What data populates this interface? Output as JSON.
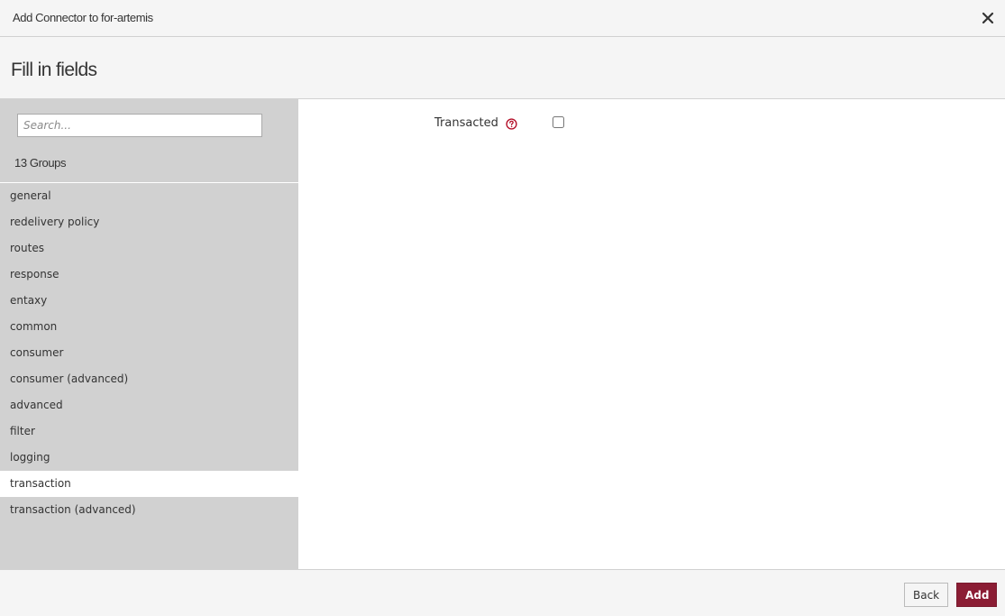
{
  "dialog": {
    "title": "Add Connector to for-artemis",
    "heading": "Fill in fields"
  },
  "icons": {
    "close": "close-icon",
    "help": "help-icon"
  },
  "colors": {
    "accent": "#8b1d34",
    "help_icon": "#b5122b",
    "sidebar_bg": "#d1d1d1",
    "selected_bg": "#ffffff"
  },
  "sidebar": {
    "search_placeholder": "Search...",
    "group_count": "13 Groups",
    "groups": [
      {
        "label": "general"
      },
      {
        "label": "redelivery policy"
      },
      {
        "label": "routes"
      },
      {
        "label": "response"
      },
      {
        "label": "entaxy"
      },
      {
        "label": "common"
      },
      {
        "label": "consumer"
      },
      {
        "label": "consumer (advanced)"
      },
      {
        "label": "advanced"
      },
      {
        "label": "filter"
      },
      {
        "label": "logging"
      },
      {
        "label": "transaction",
        "selected": true
      },
      {
        "label": "transaction (advanced)"
      }
    ]
  },
  "form": {
    "fields": [
      {
        "label": "Transacted",
        "type": "checkbox",
        "checked": false
      }
    ]
  },
  "footer": {
    "back_label": "Back",
    "add_label": "Add"
  }
}
